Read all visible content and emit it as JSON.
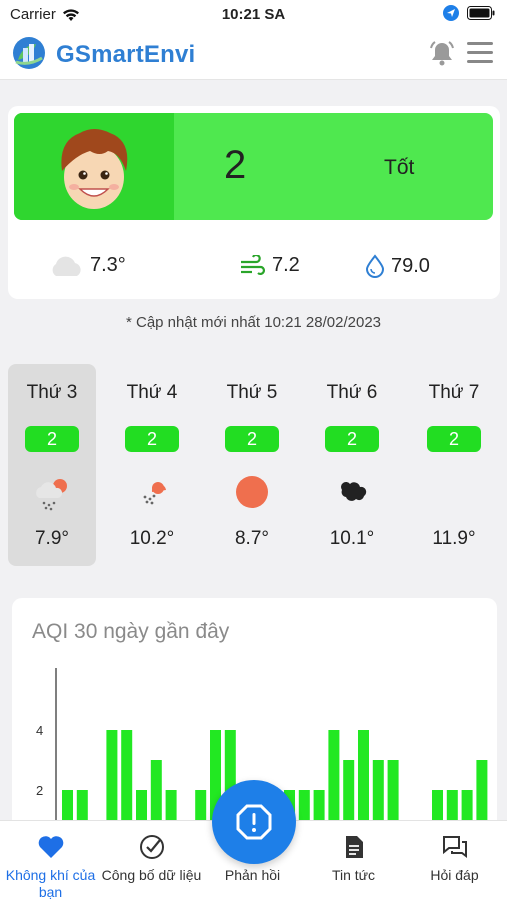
{
  "status_bar": {
    "carrier": "Carrier",
    "time": "10:21 SA"
  },
  "app": {
    "title": "GSmartEnvi"
  },
  "aqi": {
    "value": "2",
    "status": "Tốt",
    "color": "#4fe84f"
  },
  "weather": {
    "temperature": "7.3°",
    "wind": "7.2",
    "humidity": "79.0"
  },
  "updated": "* Cập nhật mới nhất 10:21 28/02/2023",
  "forecast": [
    {
      "day": "Thứ 3",
      "aqi": "2",
      "icon": "cloud-rain-sun-icon",
      "temp": "7.9°",
      "selected": true
    },
    {
      "day": "Thứ 4",
      "aqi": "2",
      "icon": "rain-sun-icon",
      "temp": "10.2°"
    },
    {
      "day": "Thứ 5",
      "aqi": "2",
      "icon": "sun-icon",
      "temp": "8.7°"
    },
    {
      "day": "Thứ 6",
      "aqi": "2",
      "icon": "dark-cloud-icon",
      "temp": "10.1°"
    },
    {
      "day": "Thứ 7",
      "aqi": "2",
      "icon": "",
      "temp": "11.9°"
    }
  ],
  "chart_title": "AQI 30 ngày gần đây",
  "chart_data": {
    "type": "bar",
    "title": "AQI 30 ngày gần đây",
    "y_ticks": [
      "4",
      "2"
    ],
    "ylim": [
      0,
      6
    ],
    "values": [
      2,
      2,
      0,
      4,
      4,
      2,
      3,
      2,
      0,
      2,
      4,
      4,
      0,
      0,
      0,
      2,
      2,
      2,
      4,
      3,
      4,
      3,
      3,
      0,
      0,
      2,
      2,
      2,
      3
    ],
    "bar_color": "#22e822"
  },
  "tabs": [
    {
      "label": "Không khí của bạn",
      "icon": "heart-icon",
      "active": true
    },
    {
      "label": "Công bố dữ liệu",
      "icon": "check-circle-icon"
    },
    {
      "label": "Phản hồi",
      "icon": "alert-icon"
    },
    {
      "label": "Tin tức",
      "icon": "document-icon"
    },
    {
      "label": "Hỏi đáp",
      "icon": "chat-icon"
    }
  ],
  "colors": {
    "accent": "#1e7fe8",
    "title": "#2f7fd3",
    "good": "#22dd22"
  }
}
